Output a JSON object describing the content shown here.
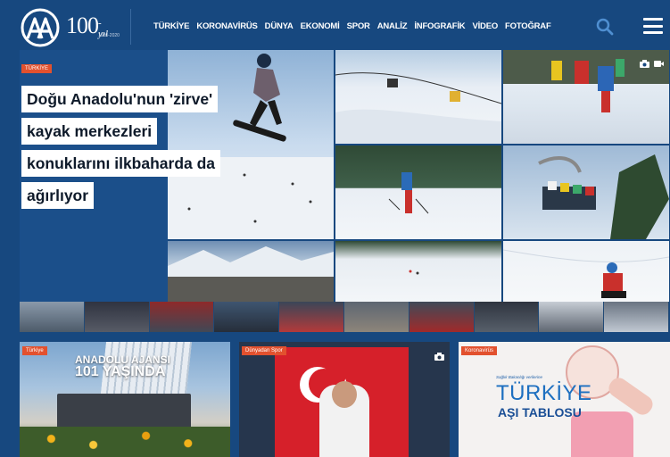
{
  "header": {
    "logo_text": "AA",
    "centennial": {
      "number": "100",
      "suffix": "-yıl",
      "years": "1920-2020"
    },
    "nav": [
      "TÜRKİYE",
      "KORONAVİRÜS",
      "DÜNYA",
      "EKONOMİ",
      "SPOR",
      "ANALİZ",
      "İNFOGRAFİK",
      "VİDEO",
      "FOTOĞRAF"
    ],
    "icons": {
      "search": "search-icon",
      "menu": "hamburger-menu-icon"
    }
  },
  "hero": {
    "category": "TÜRKİYE",
    "headline_lines": [
      "Doğu Anadolu'nun 'zirve'",
      "kayak merkezleri",
      "konuklarını ilkbaharda da",
      "ağırlıyor"
    ],
    "media_icons": [
      "camera-icon",
      "video-icon"
    ]
  },
  "cards": [
    {
      "category": "Türkiye",
      "image_text_line1": "ANADOLU AJANSI",
      "image_text_line2": "101 YAŞINDA"
    },
    {
      "category": "Dünyadan Spor",
      "media_icon": "camera-icon"
    },
    {
      "category": "Koronavirüs",
      "image_small_text": "Sağlık Bakanlığı verilerine",
      "image_text_line1": "TÜRKİYE",
      "image_text_line2": "AŞI TABLOSU"
    }
  ],
  "colors": {
    "brand_blue": "#17487f",
    "tag_orange": "#e2512e",
    "white": "#ffffff"
  }
}
